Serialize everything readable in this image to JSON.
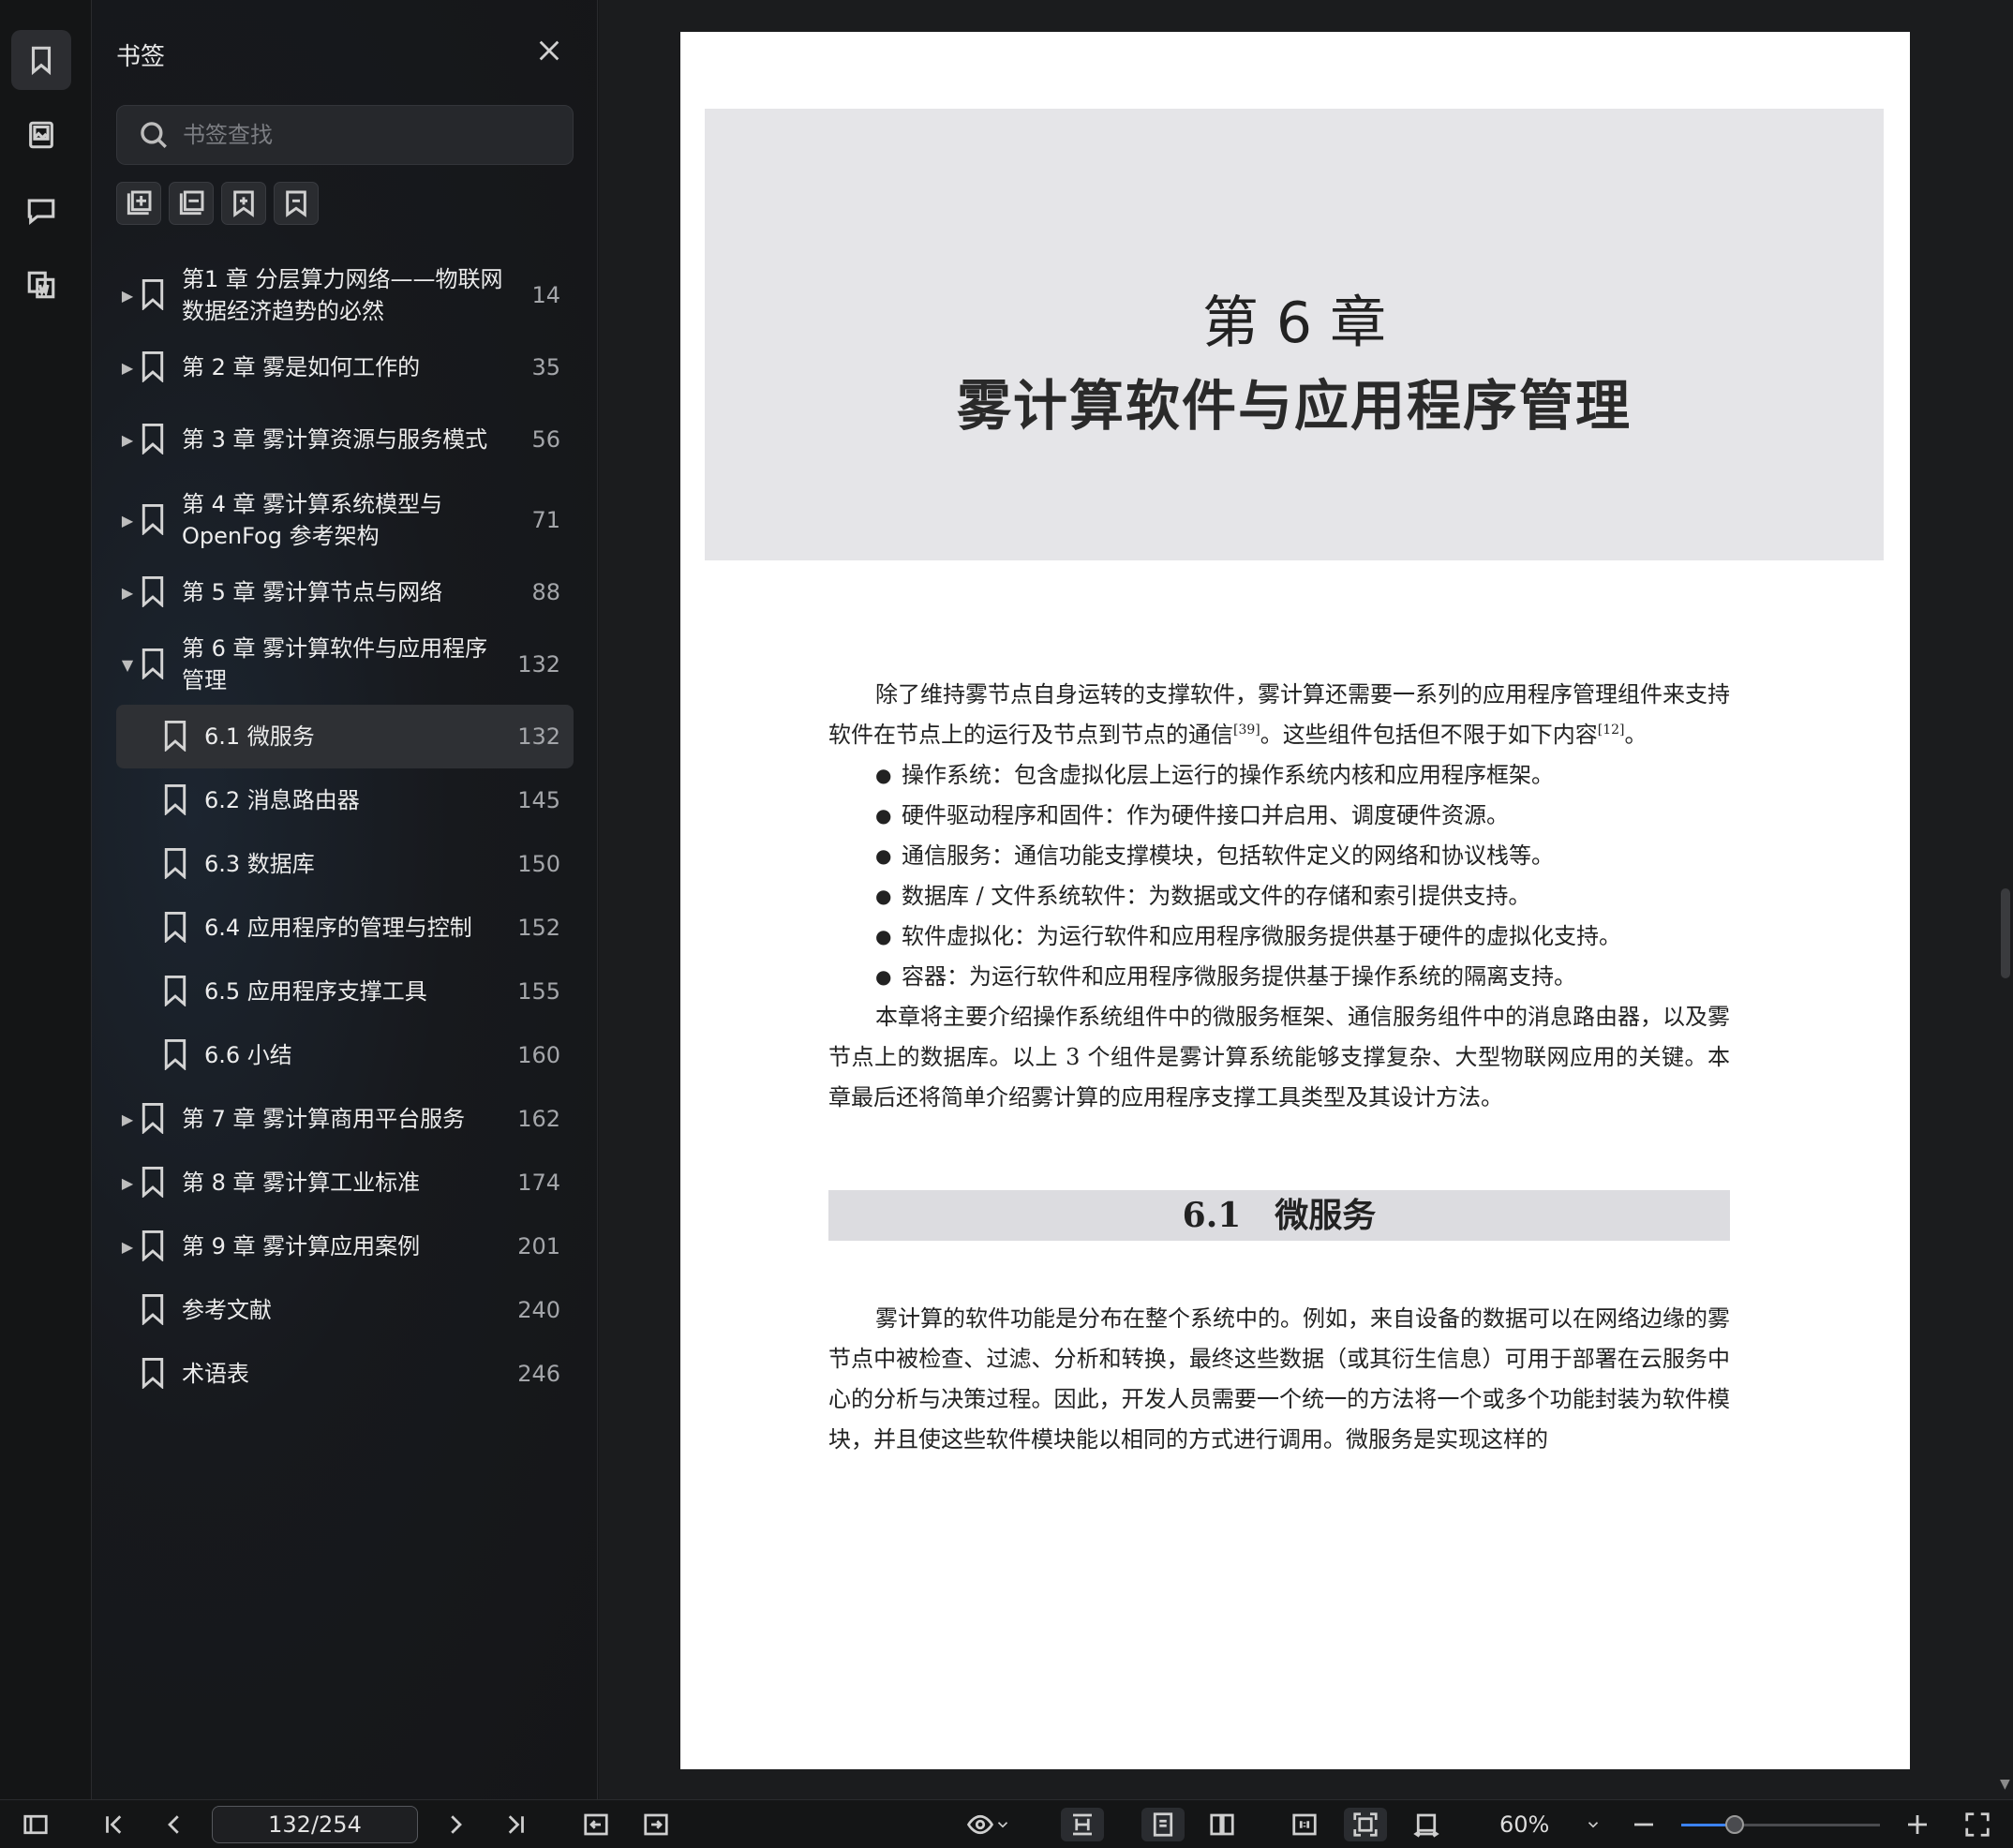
{
  "panel": {
    "title": "书签",
    "search_placeholder": "书签查找"
  },
  "tree": [
    {
      "label": "第1 章 分层算力网络——物联网数据经济趋势的必然",
      "page": "14",
      "expandable": true,
      "expanded": false,
      "level": 0,
      "selected": false
    },
    {
      "label": "第 2 章 雾是如何工作的",
      "page": "35",
      "expandable": true,
      "expanded": false,
      "level": 0,
      "selected": false
    },
    {
      "label": "第 3 章 雾计算资源与服务模式",
      "page": "56",
      "expandable": true,
      "expanded": false,
      "level": 0,
      "selected": false
    },
    {
      "label": "第 4 章 雾计算系统模型与 OpenFog 参考架构",
      "page": "71",
      "expandable": true,
      "expanded": false,
      "level": 0,
      "selected": false
    },
    {
      "label": "第 5 章 雾计算节点与网络",
      "page": "88",
      "expandable": true,
      "expanded": false,
      "level": 0,
      "selected": false
    },
    {
      "label": "第 6 章 雾计算软件与应用程序管理",
      "page": "132",
      "expandable": true,
      "expanded": true,
      "level": 0,
      "selected": false
    },
    {
      "label": "6.1 微服务",
      "page": "132",
      "expandable": false,
      "expanded": false,
      "level": 1,
      "selected": true
    },
    {
      "label": "6.2 消息路由器",
      "page": "145",
      "expandable": false,
      "expanded": false,
      "level": 1,
      "selected": false
    },
    {
      "label": "6.3 数据库",
      "page": "150",
      "expandable": false,
      "expanded": false,
      "level": 1,
      "selected": false
    },
    {
      "label": "6.4 应用程序的管理与控制",
      "page": "152",
      "expandable": false,
      "expanded": false,
      "level": 1,
      "selected": false
    },
    {
      "label": "6.5 应用程序支撑工具",
      "page": "155",
      "expandable": false,
      "expanded": false,
      "level": 1,
      "selected": false
    },
    {
      "label": "6.6 小结",
      "page": "160",
      "expandable": false,
      "expanded": false,
      "level": 1,
      "selected": false
    },
    {
      "label": "第 7 章 雾计算商用平台服务",
      "page": "162",
      "expandable": true,
      "expanded": false,
      "level": 0,
      "selected": false
    },
    {
      "label": "第 8 章 雾计算工业标准",
      "page": "174",
      "expandable": true,
      "expanded": false,
      "level": 0,
      "selected": false
    },
    {
      "label": "第 9 章 雾计算应用案例",
      "page": "201",
      "expandable": true,
      "expanded": false,
      "level": 0,
      "selected": false
    },
    {
      "label": "参考文献",
      "page": "240",
      "expandable": false,
      "expanded": false,
      "level": 0,
      "selected": false
    },
    {
      "label": "术语表",
      "page": "246",
      "expandable": false,
      "expanded": false,
      "level": 0,
      "selected": false
    }
  ],
  "page": {
    "chapter_no": "第 6 章",
    "chapter_title": "雾计算软件与应用程序管理",
    "intro_a": "除了维持雾节点自身运转的支撑软件，雾计算还需要一系列的应用程序管理组件来支持软件在节点上的运行及节点到节点的通信",
    "ref_a": "[39]",
    "intro_b": "。这些组件包括但不限于如下内容",
    "ref_b": "[12]",
    "intro_c": "。",
    "bullets": [
      "操作系统：包含虚拟化层上运行的操作系统内核和应用程序框架。",
      "硬件驱动程序和固件：作为硬件接口并启用、调度硬件资源。",
      "通信服务：通信功能支撑模块，包括软件定义的网络和协议栈等。",
      "数据库 / 文件系统软件：为数据或文件的存储和索引提供支持。",
      "软件虚拟化：为运行软件和应用程序微服务提供基于硬件的虚拟化支持。",
      "容器：为运行软件和应用程序微服务提供基于操作系统的隔离支持。"
    ],
    "summary": "本章将主要介绍操作系统组件中的微服务框架、通信服务组件中的消息路由器，以及雾节点上的数据库。以上 3 个组件是雾计算系统能够支撑复杂、大型物联网应用的关键。本章最后还将简单介绍雾计算的应用程序支撑工具类型及其设计方法。",
    "section_heading": "6.1　微服务",
    "section_para": "雾计算的软件功能是分布在整个系统中的。例如，来自设备的数据可以在网络边缘的雾节点中被检查、过滤、分析和转换，最终这些数据（或其衍生信息）可用于部署在云服务中心的分析与决策过程。因此，开发人员需要一个统一的方法将一个或多个功能封装为软件模块，并且使这些软件模块能以相同的方式进行调用。微服务是实现这样的"
  },
  "toolbar": {
    "page_indicator": "132/254",
    "zoom": "60%",
    "zoom_fraction": 0.27
  }
}
